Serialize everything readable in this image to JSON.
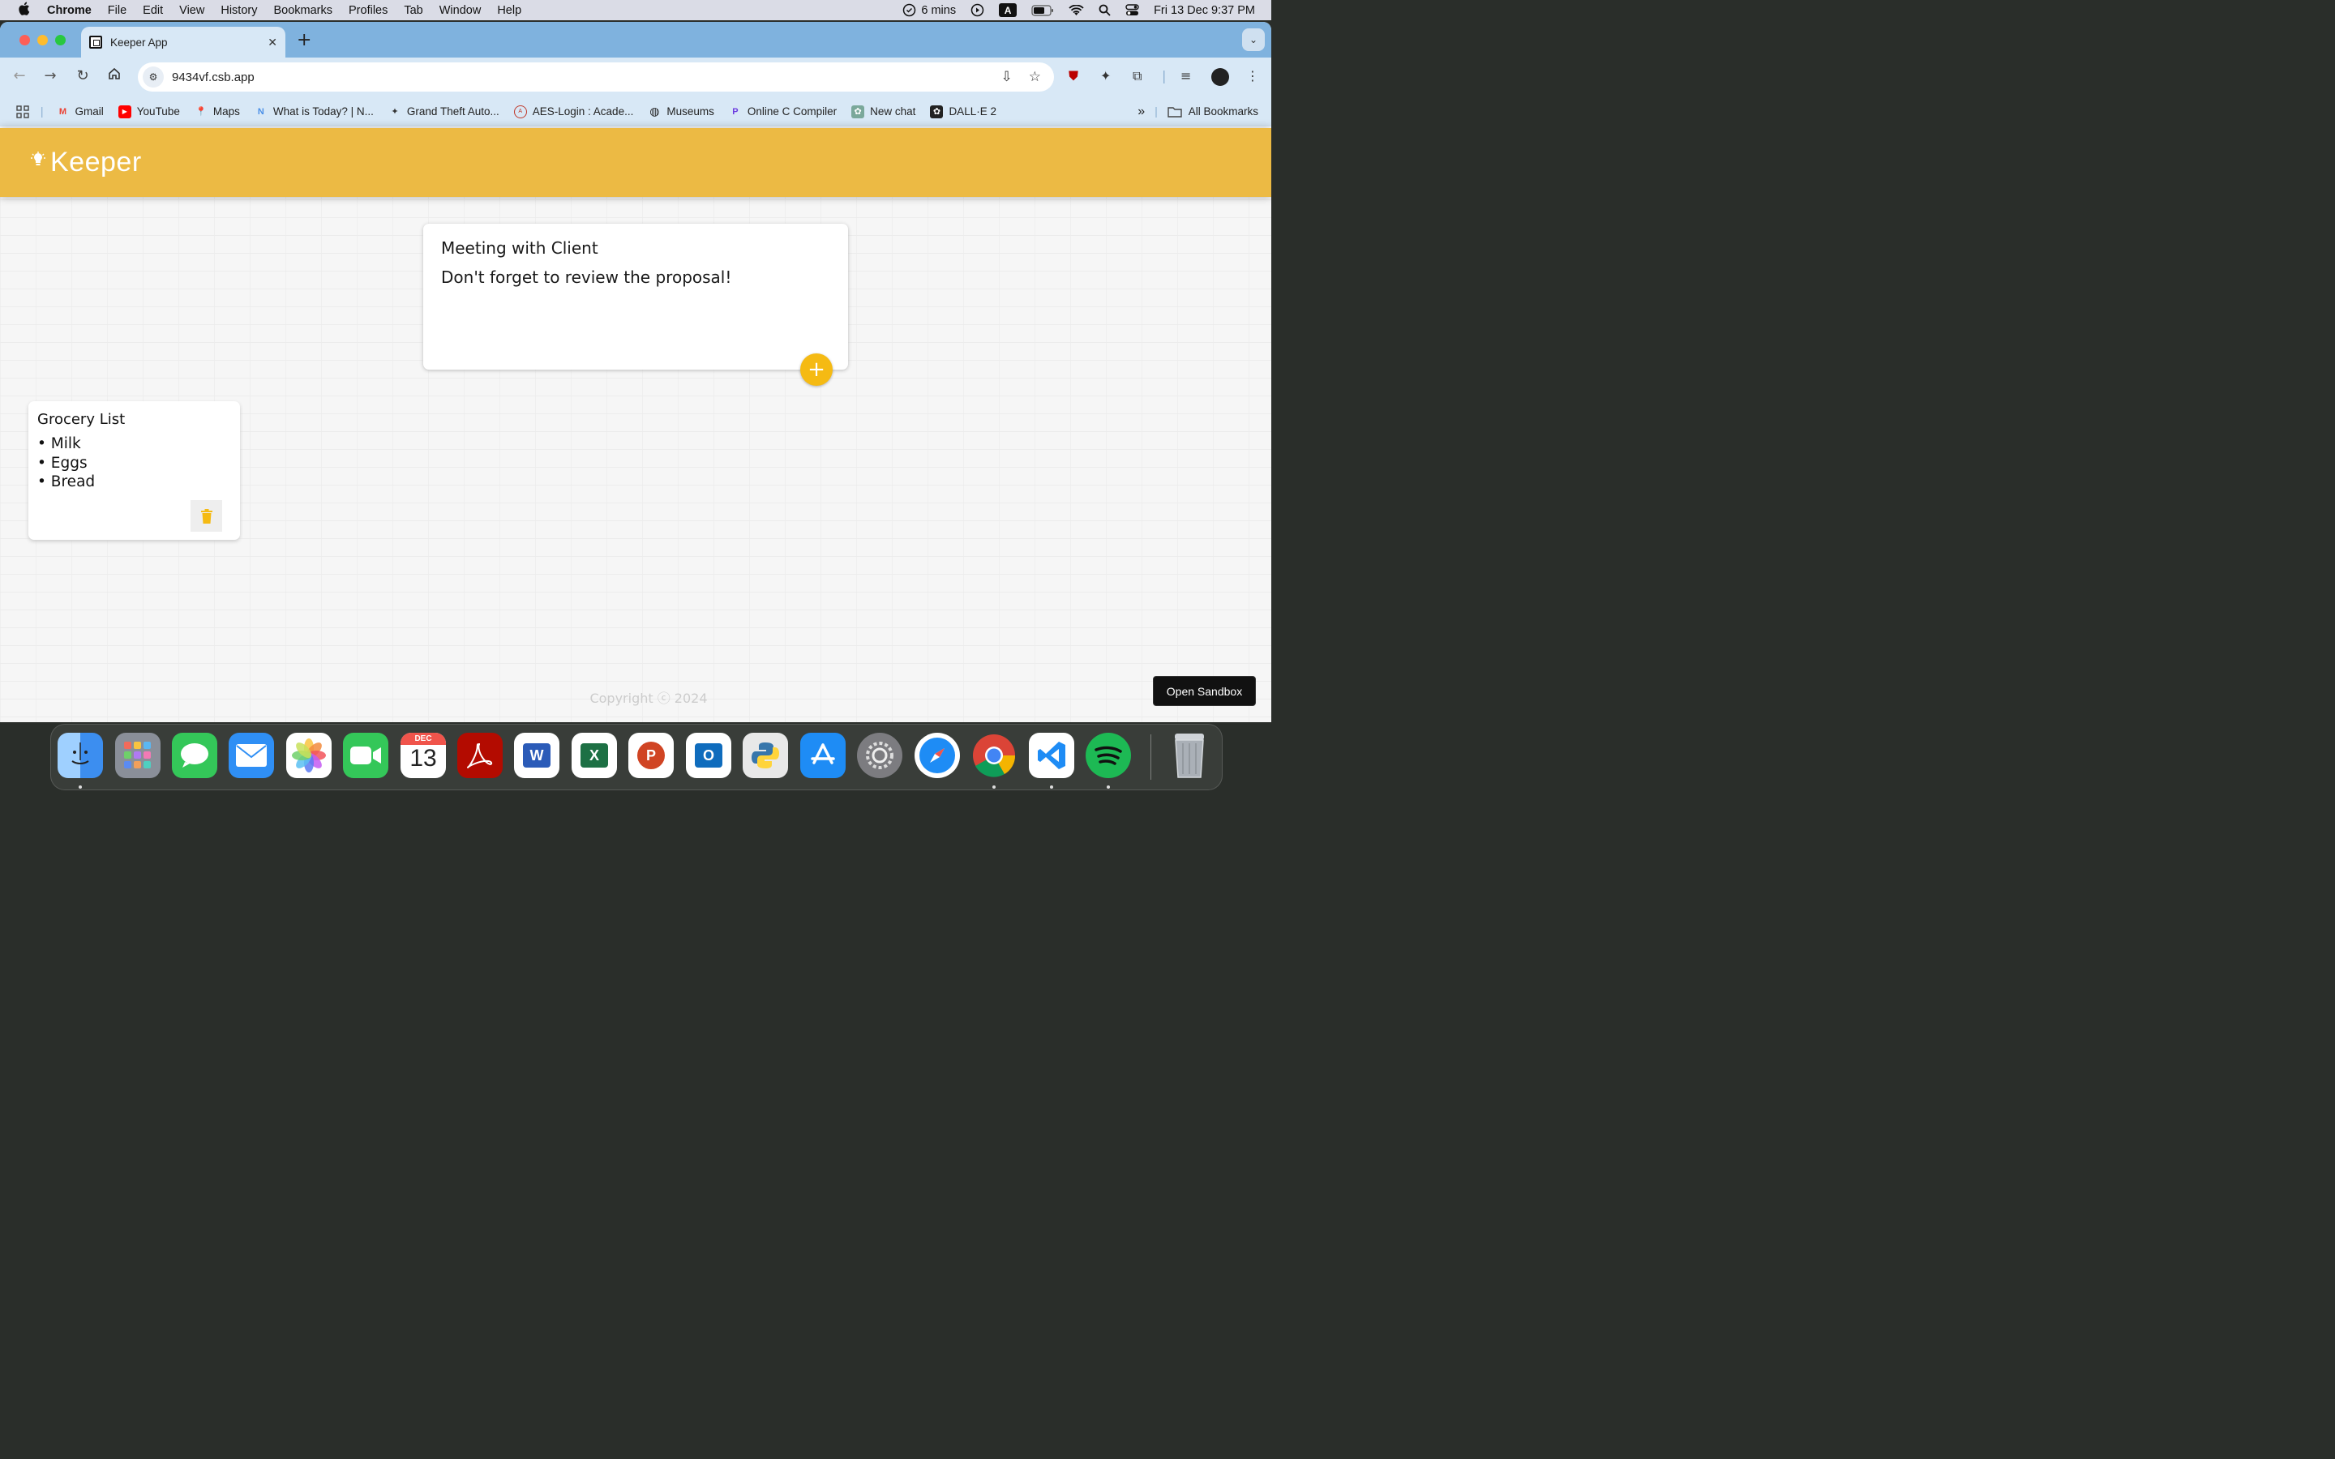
{
  "menubar": {
    "app_name": "Chrome",
    "menus": [
      "File",
      "Edit",
      "View",
      "History",
      "Bookmarks",
      "Profiles",
      "Tab",
      "Window",
      "Help"
    ],
    "timer": "6 mins",
    "input_source": "A",
    "datetime": "Fri 13 Dec  9:37 PM"
  },
  "browser": {
    "tab_title": "Keeper App",
    "url": "9434vf.csb.app",
    "bookmarks": [
      {
        "label": "Gmail",
        "icon": "gmail-icon",
        "color": "#ea4335",
        "glyph": "M"
      },
      {
        "label": "YouTube",
        "icon": "youtube-icon",
        "color": "#ff0000",
        "glyph": "▶"
      },
      {
        "label": "Maps",
        "icon": "maps-icon",
        "color": "#34a853",
        "glyph": "⬤"
      },
      {
        "label": "What is Today? | N...",
        "icon": "nt-icon",
        "color": "#4a8fe7",
        "glyph": "N"
      },
      {
        "label": "Grand Theft Auto...",
        "icon": "gta-icon",
        "color": "#333333",
        "glyph": "✦"
      },
      {
        "label": "AES-Login : Acade...",
        "icon": "aes-icon",
        "color": "#c0392b",
        "glyph": "A"
      },
      {
        "label": "Museums",
        "icon": "globe-icon",
        "color": "#222222",
        "glyph": "◍"
      },
      {
        "label": "Online C Compiler",
        "icon": "compiler-icon",
        "color": "#6c3ce0",
        "glyph": "P"
      },
      {
        "label": "New chat",
        "icon": "chatgpt-icon",
        "color": "#7aa89a",
        "glyph": "✿"
      },
      {
        "label": "DALL·E 2",
        "icon": "dalle-icon",
        "color": "#222222",
        "glyph": "✿"
      }
    ],
    "all_bookmarks": "All Bookmarks"
  },
  "app": {
    "brand": "Keeper",
    "brand_color": "#ecba44",
    "create_note": {
      "title": "Meeting with Client",
      "content": "Don't forget to review the proposal!",
      "add_label": "+"
    },
    "notes": [
      {
        "title": "Grocery List",
        "lines": [
          "• Milk",
          "• Eggs",
          "• Bread"
        ]
      }
    ],
    "footer": "Copyright ⓒ 2024",
    "sandbox_button": "Open Sandbox"
  },
  "dock": {
    "apps": [
      {
        "name": "finder-icon",
        "color": "#3c8ef0"
      },
      {
        "name": "launchpad-icon",
        "color": "#8a8f99"
      },
      {
        "name": "messages-icon",
        "color": "#34c759"
      },
      {
        "name": "mail-icon",
        "color": "#2f8ff5"
      },
      {
        "name": "photos-icon",
        "color": "#ffffff"
      },
      {
        "name": "facetime-icon",
        "color": "#34c759"
      },
      {
        "name": "calendar-icon",
        "color": "#ffffff"
      },
      {
        "name": "acrobat-icon",
        "color": "#b30b00"
      },
      {
        "name": "word-icon",
        "color": "#ffffff"
      },
      {
        "name": "excel-icon",
        "color": "#ffffff"
      },
      {
        "name": "powerpoint-icon",
        "color": "#ffffff"
      },
      {
        "name": "outlook-icon",
        "color": "#ffffff"
      },
      {
        "name": "python-icon",
        "color": "#e8e8e8"
      },
      {
        "name": "app-store-icon",
        "color": "#1e8cf5"
      },
      {
        "name": "system-settings-icon",
        "color": "#7c7c80"
      },
      {
        "name": "safari-icon",
        "color": "#ffffff"
      },
      {
        "name": "chrome-icon",
        "color": "#ffffff"
      },
      {
        "name": "vscode-icon",
        "color": "#ffffff"
      },
      {
        "name": "spotify-icon",
        "color": "#1db954"
      },
      {
        "name": "trash-icon",
        "color": "#9aa0a6"
      }
    ],
    "calendar_month": "DEC",
    "calendar_day": "13"
  }
}
